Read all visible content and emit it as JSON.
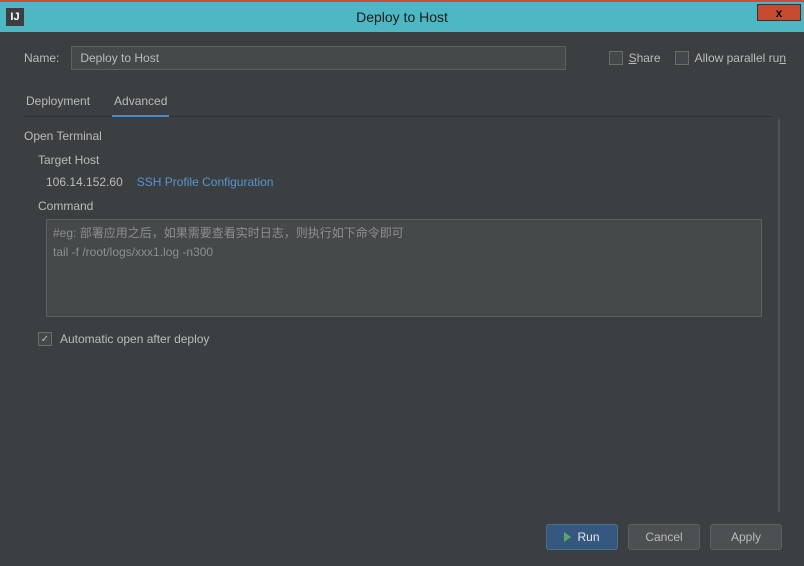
{
  "window": {
    "title": "Deploy to Host",
    "close": "x"
  },
  "name": {
    "label": "Name:",
    "value": "Deploy to Host"
  },
  "options": {
    "share_label": "Share",
    "parallel_label": "Allow parallel run"
  },
  "tabs": {
    "deployment": "Deployment",
    "advanced": "Advanced"
  },
  "terminal": {
    "header": "Open Terminal",
    "target_host_label": "Target Host",
    "host_ip": "106.14.152.60",
    "ssh_link": "SSH Profile Configuration",
    "command_label": "Command",
    "command_value": "#eg: 部署应用之后，如果需要查看实时日志，则执行如下命令即可\ntail -f /root/logs/xxx1.log -n300",
    "auto_open_label": "Automatic open after deploy"
  },
  "buttons": {
    "run": "Run",
    "cancel": "Cancel",
    "apply": "Apply"
  }
}
